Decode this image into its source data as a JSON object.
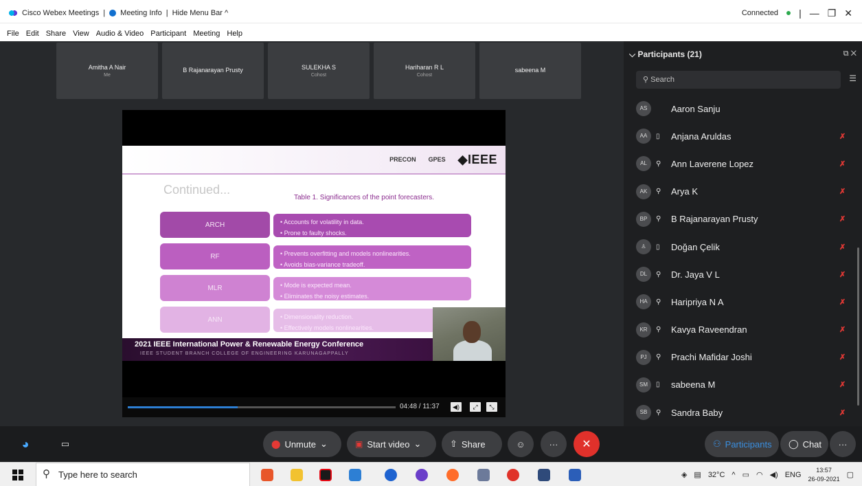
{
  "window": {
    "app_title": "Cisco Webex Meetings",
    "meeting_info": "Meeting Info",
    "hide_menu": "Hide Menu Bar ^",
    "status": "Connected"
  },
  "menu": [
    "File",
    "Edit",
    "Share",
    "View",
    "Audio & Video",
    "Participant",
    "Meeting",
    "Help"
  ],
  "thumbnails": [
    {
      "name": "Amitha A Nair",
      "sub": "Me"
    },
    {
      "name": "B Rajanarayan Prusty",
      "sub": ""
    },
    {
      "name": "SULEKHA S",
      "sub": "Cohost"
    },
    {
      "name": "Hariharan R L",
      "sub": "Cohost"
    },
    {
      "name": "sabeena M",
      "sub": ""
    }
  ],
  "slide": {
    "logos": [
      "PRECON",
      "GPES",
      "IEEE"
    ],
    "continued": "Continued...",
    "caption": "Table 1. Significances of the point forecasters.",
    "rows": [
      {
        "label": "ARCH",
        "d1": "• Accounts for volatility in data.",
        "d2": "• Prone to faulty shocks.",
        "lbl_color": "#a24aa8",
        "desc_color": "#a84bb0"
      },
      {
        "label": "RF",
        "d1": "• Prevents overfitting and models nonlinearities.",
        "d2": "• Avoids bias-variance tradeoff.",
        "lbl_color": "#bb5fc0",
        "desc_color": "#bf62c4"
      },
      {
        "label": "MLR",
        "d1": "• Mode is expected mean.",
        "d2": "• Eliminates the noisy estimates.",
        "lbl_color": "#cf82d2",
        "desc_color": "#d58ad8"
      },
      {
        "label": "ANN",
        "d1": "• Dimensionality reduction.",
        "d2": "• Effectively models nonlinearities.",
        "lbl_color": "#e2b3e4",
        "desc_color": "#e6bde8"
      }
    ],
    "footer_title": "2021 IEEE International Power & Renewable Energy Conference",
    "footer_sub": "IEEE STUDENT BRANCH COLLEGE OF ENGINEERING KARUNAGAPPALLY"
  },
  "player": {
    "time": "04:48 / 11:37",
    "progress": 0.41
  },
  "participants": {
    "header": "Participants (21)",
    "search_placeholder": "Search",
    "list": [
      {
        "initials": "AS",
        "device": "",
        "name": "Aaron Sanju",
        "muted": false
      },
      {
        "initials": "AA",
        "device": "▯",
        "name": "Anjana Aruldas",
        "muted": true
      },
      {
        "initials": "AL",
        "device": "⚲",
        "name": "Ann Laverene Lopez",
        "muted": true
      },
      {
        "initials": "AK",
        "device": "⚲",
        "name": "Arya K",
        "muted": true
      },
      {
        "initials": "BP",
        "device": "⚲",
        "name": "B Rajanarayan Prusty",
        "muted": true
      },
      {
        "initials": "",
        "device": "▯",
        "name": "Doğan Çelik",
        "muted": true
      },
      {
        "initials": "DL",
        "device": "⚲",
        "name": "Dr. Jaya V L",
        "muted": true
      },
      {
        "initials": "HA",
        "device": "⚲",
        "name": "Haripriya N A",
        "muted": true
      },
      {
        "initials": "KR",
        "device": "⚲",
        "name": "Kavya Raveendran",
        "muted": true
      },
      {
        "initials": "PJ",
        "device": "⚲",
        "name": "Prachi Mafidar Joshi",
        "muted": true
      },
      {
        "initials": "SM",
        "device": "▯",
        "name": "sabeena M",
        "muted": true
      },
      {
        "initials": "SB",
        "device": "⚲",
        "name": "Sandra Baby",
        "muted": true
      }
    ]
  },
  "controls": {
    "unmute": "Unmute",
    "start_video": "Start video",
    "share": "Share",
    "participants": "Participants",
    "chat": "Chat"
  },
  "taskbar": {
    "search_placeholder": "Type here to search",
    "temp": "32°C",
    "lang": "ENG",
    "time": "13:57",
    "date": "26-09-2021"
  },
  "colors": {
    "accent": "#2d7fd4",
    "leave": "#e0312b",
    "muted": "#e53935"
  }
}
